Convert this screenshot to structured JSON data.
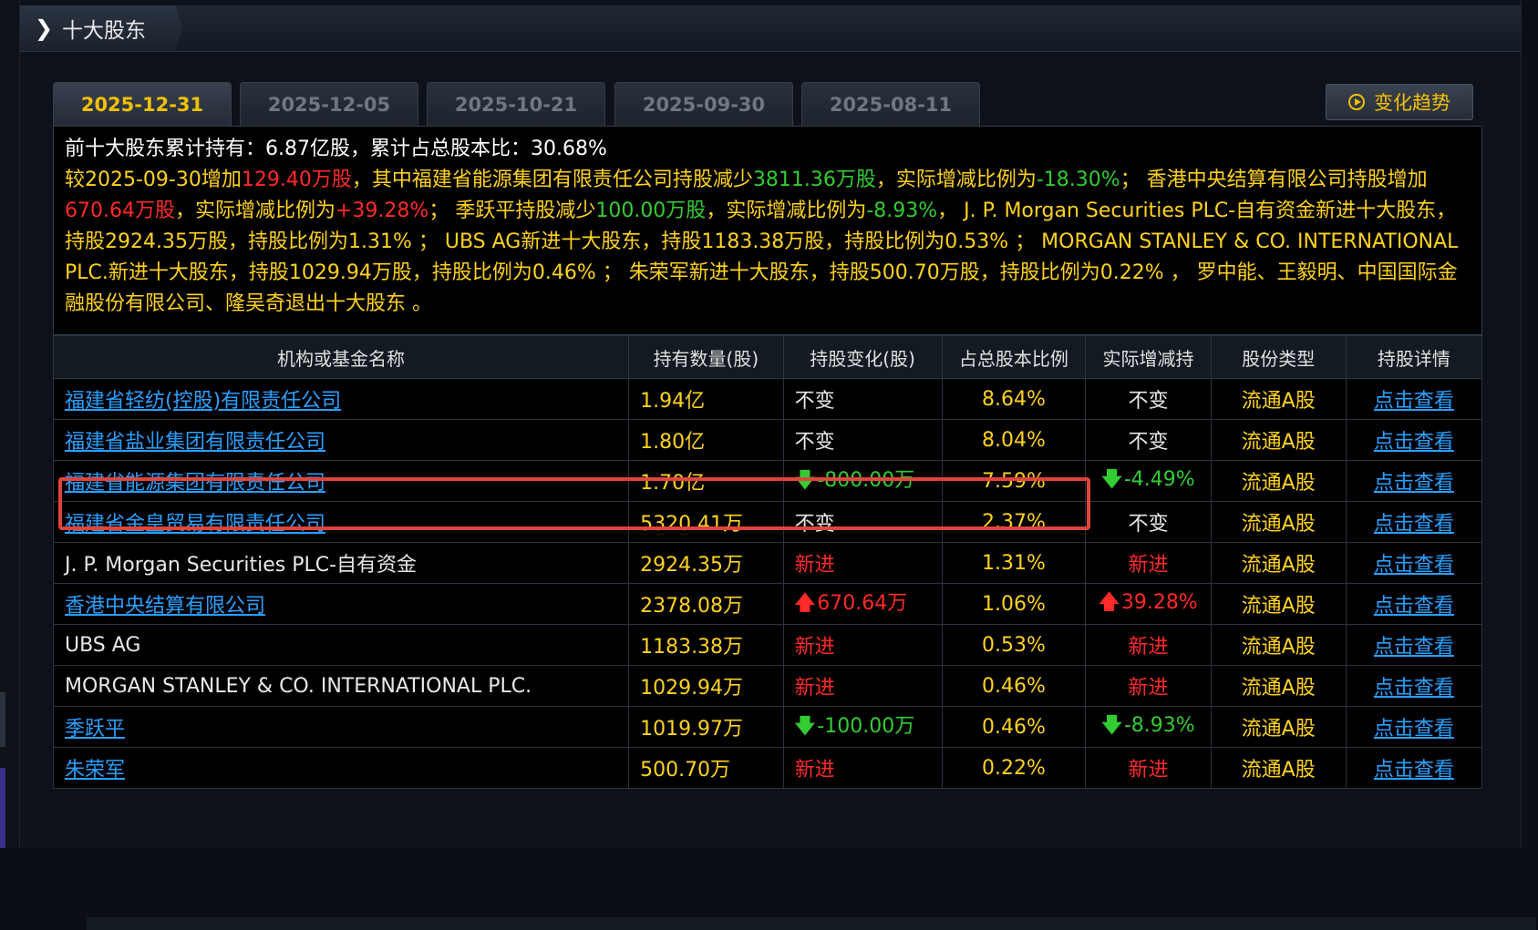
{
  "section_title": "十大股东",
  "tabs": [
    "2025-12-31",
    "2025-12-05",
    "2025-10-21",
    "2025-09-30",
    "2025-08-11"
  ],
  "active_tab": 0,
  "trend_button": "变化趋势",
  "summary": {
    "line1_prefix": "前十大股东累计持有：",
    "total_shares": "6.87亿股",
    "line1_mid": "，累计占总股本比：",
    "total_pct": "30.68%",
    "p1": "较2025-09-30增加",
    "v1": "129.40万股",
    "p2": "，其中福建省能源集团有限责任公司持股减少",
    "v2": "3811.36万股",
    "p3": "，实际增减比例为",
    "v3": "-18.30%",
    "p4": "； 香港中央结算有限公司持股增加",
    "v4": "670.64万股",
    "p5": "，实际增减比例为",
    "v5": "+39.28%",
    "p6": "； 季跃平持股减少",
    "v6": "100.00万股",
    "p7": "，实际增减比例为",
    "v7": "-8.93%",
    "p8": "， J. P. Morgan Securities PLC-自有资金新进十大股东，持股2924.35万股，持股比例为1.31% ； UBS AG新进十大股东，持股1183.38万股，持股比例为0.53% ； MORGAN STANLEY & CO. INTERNATIONAL PLC.新进十大股东，持股1029.94万股，持股比例为0.46% ； 朱荣军新进十大股东，持股500.70万股，持股比例为0.22% ， 罗中能、王毅明、中国国际金融股份有限公司、隆吴奇退出十大股东 。"
  },
  "columns": [
    "机构或基金名称",
    "持有数量(股)",
    "持股变化(股)",
    "占总股本比例",
    "实际增减持",
    "股份类型",
    "持股详情"
  ],
  "rows": [
    {
      "name": "福建省轻纺(控股)有限责任公司",
      "link": true,
      "qty": "1.94亿",
      "chg": "不变",
      "chg_dir": "none",
      "pct": "8.64%",
      "act": "不变",
      "act_dir": "none",
      "type": "流通A股",
      "detail": "点击查看"
    },
    {
      "name": "福建省盐业集团有限责任公司",
      "link": true,
      "qty": "1.80亿",
      "chg": "不变",
      "chg_dir": "none",
      "pct": "8.04%",
      "act": "不变",
      "act_dir": "none",
      "type": "流通A股",
      "detail": "点击查看"
    },
    {
      "name": "福建省能源集团有限责任公司",
      "link": true,
      "qty": "1.70亿",
      "chg": "-800.00万",
      "chg_dir": "down",
      "pct": "7.59%",
      "act": "-4.49%",
      "act_dir": "down",
      "type": "流通A股",
      "detail": "点击查看"
    },
    {
      "name": "福建省金皇贸易有限责任公司",
      "link": true,
      "qty": "5320.41万",
      "chg": "不变",
      "chg_dir": "none",
      "pct": "2.37%",
      "act": "不变",
      "act_dir": "none",
      "type": "流通A股",
      "detail": "点击查看"
    },
    {
      "name": "J. P. Morgan Securities PLC-自有资金",
      "link": false,
      "qty": "2924.35万",
      "chg": "新进",
      "chg_dir": "new",
      "pct": "1.31%",
      "act": "新进",
      "act_dir": "new",
      "type": "流通A股",
      "detail": "点击查看"
    },
    {
      "name": "香港中央结算有限公司",
      "link": true,
      "qty": "2378.08万",
      "chg": "670.64万",
      "chg_dir": "up",
      "pct": "1.06%",
      "act": "39.28%",
      "act_dir": "up",
      "type": "流通A股",
      "detail": "点击查看"
    },
    {
      "name": "UBS AG",
      "link": false,
      "qty": "1183.38万",
      "chg": "新进",
      "chg_dir": "new",
      "pct": "0.53%",
      "act": "新进",
      "act_dir": "new",
      "type": "流通A股",
      "detail": "点击查看"
    },
    {
      "name": "MORGAN STANLEY & CO. INTERNATIONAL PLC.",
      "link": false,
      "qty": "1029.94万",
      "chg": "新进",
      "chg_dir": "new",
      "pct": "0.46%",
      "act": "新进",
      "act_dir": "new",
      "type": "流通A股",
      "detail": "点击查看"
    },
    {
      "name": "季跃平",
      "link": true,
      "qty": "1019.97万",
      "chg": "-100.00万",
      "chg_dir": "down",
      "pct": "0.46%",
      "act": "-8.93%",
      "act_dir": "down",
      "type": "流通A股",
      "detail": "点击查看"
    },
    {
      "name": "朱荣军",
      "link": true,
      "qty": "500.70万",
      "chg": "新进",
      "chg_dir": "new",
      "pct": "0.22%",
      "act": "新进",
      "act_dir": "new",
      "type": "流通A股",
      "detail": "点击查看"
    }
  ]
}
